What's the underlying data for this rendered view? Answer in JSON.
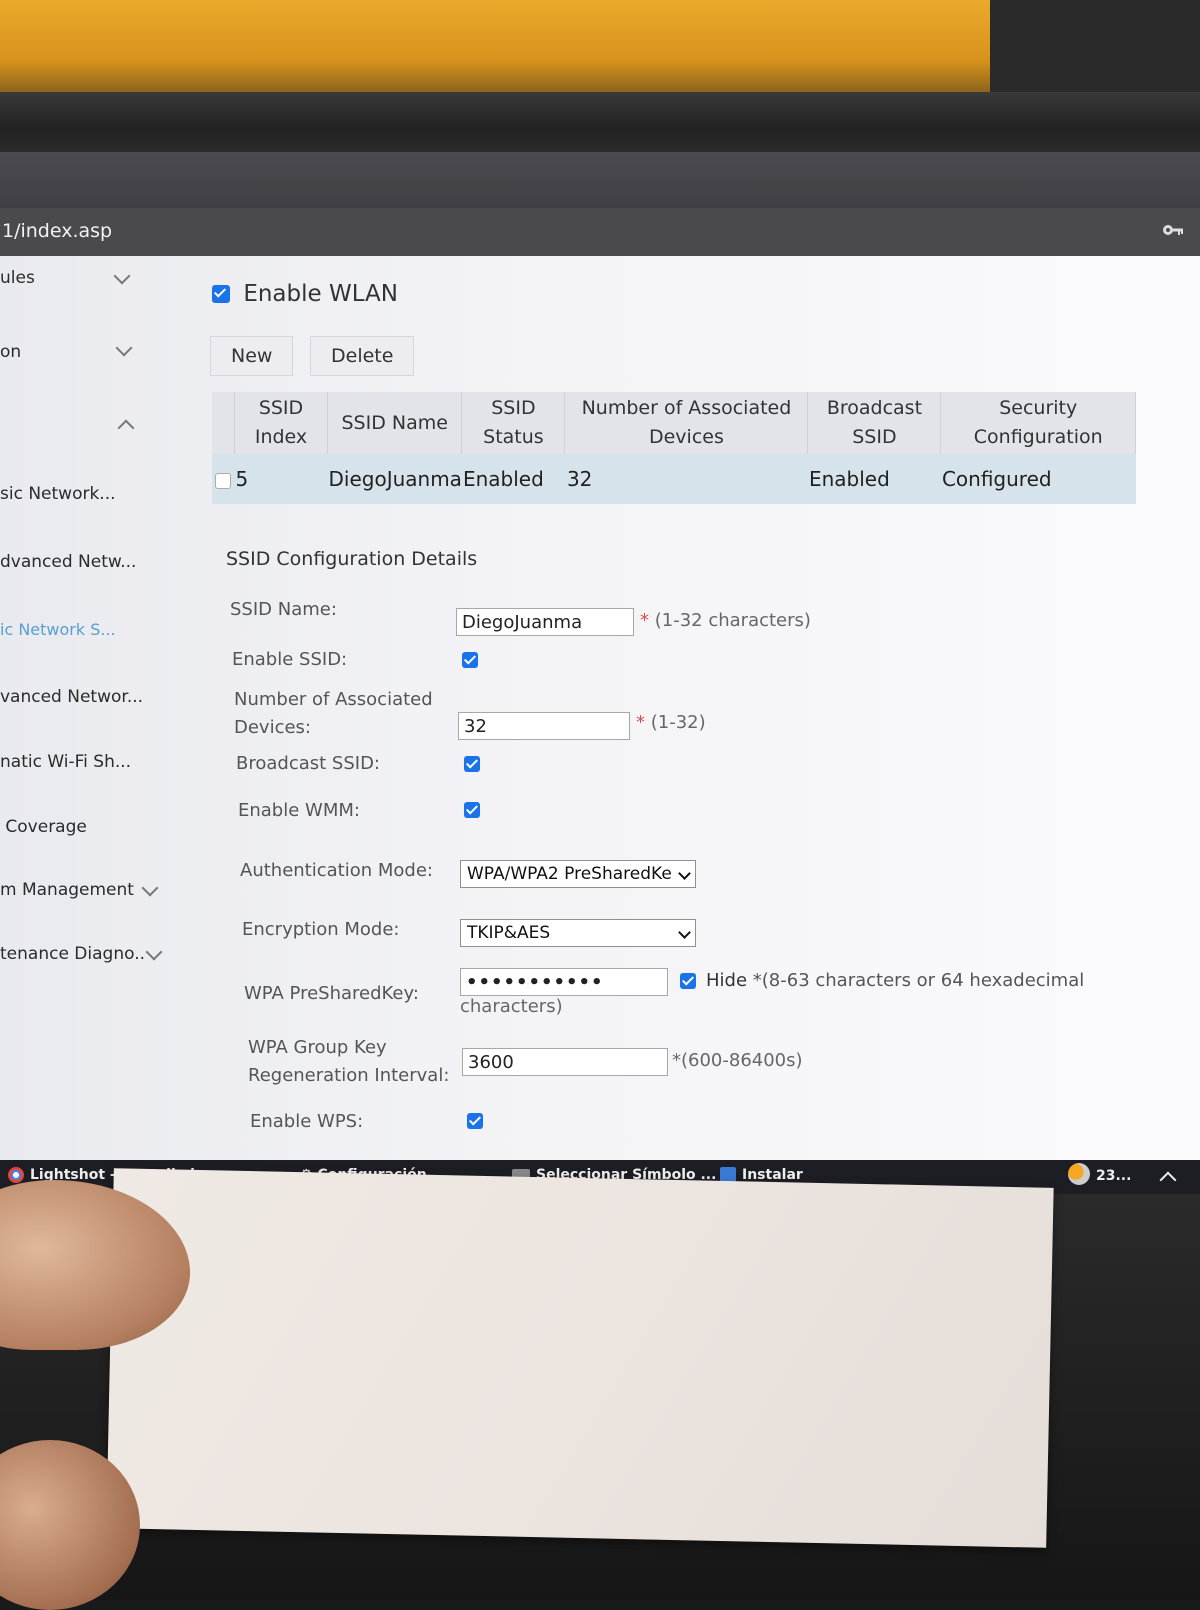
{
  "browser": {
    "url": "1/index.asp"
  },
  "sidebar": {
    "items": [
      {
        "label": "ules",
        "chevron": "down"
      },
      {
        "label": "on",
        "chevron": "down"
      },
      {
        "label": "",
        "chevron": "up"
      },
      {
        "label": "sic Network...",
        "chevron": ""
      },
      {
        "label": "dvanced Netw...",
        "chevron": ""
      },
      {
        "label": "ic Network S...",
        "chevron": "",
        "active": true
      },
      {
        "label": "vanced Networ...",
        "chevron": ""
      },
      {
        "label": "natic Wi-Fi Sh...",
        "chevron": ""
      },
      {
        "label": " Coverage",
        "chevron": ""
      },
      {
        "label": "m Management",
        "chevron": "down"
      },
      {
        "label": "tenance Diagno..",
        "chevron": "down"
      }
    ]
  },
  "wlan": {
    "enable_label": "Enable WLAN",
    "enable_checked": true,
    "new_label": "New",
    "delete_label": "Delete"
  },
  "ssid_table": {
    "headers": [
      "SSID Index",
      "SSID Name",
      "SSID Status",
      "Number of Associated Devices",
      "Broadcast SSID",
      "Security Configuration"
    ],
    "rows": [
      {
        "index": "5",
        "name": "DiegoJuanma",
        "status": "Enabled",
        "devices": "32",
        "broadcast": "Enabled",
        "security": "Configured"
      }
    ]
  },
  "details": {
    "title": "SSID Configuration Details",
    "ssid_name_label": "SSID Name:",
    "ssid_name_value": "DiegoJuanma",
    "ssid_name_hint": "(1-32 characters)",
    "enable_ssid_label": "Enable SSID:",
    "devices_label_1": "Number of Associated",
    "devices_label_2": "Devices:",
    "devices_value": "32",
    "devices_hint": "(1-32)",
    "broadcast_label": "Broadcast SSID:",
    "wmm_label": "Enable WMM:",
    "auth_label": "Authentication Mode:",
    "auth_value": "WPA/WPA2 PreSharedKe",
    "enc_label": "Encryption Mode:",
    "enc_value": "TKIP&AES",
    "psk_label": "WPA PreSharedKey:",
    "psk_value": "•••••••••••",
    "psk_hide_label": "Hide",
    "psk_hint_1": "*(8-63 characters or 64 hexadecimal",
    "psk_hint_2": "characters)",
    "group_label_1": "WPA Group Key",
    "group_label_2": "Regeneration Interval:",
    "group_value": "3600",
    "group_hint": "*(600-86400s)",
    "wps_label": "Enable WPS:"
  },
  "taskbar": {
    "items": [
      "Lightshot - pantalla h",
      "Configuración",
      "Seleccionar Símbolo ...",
      "Instalar"
    ],
    "weather": "23..."
  }
}
